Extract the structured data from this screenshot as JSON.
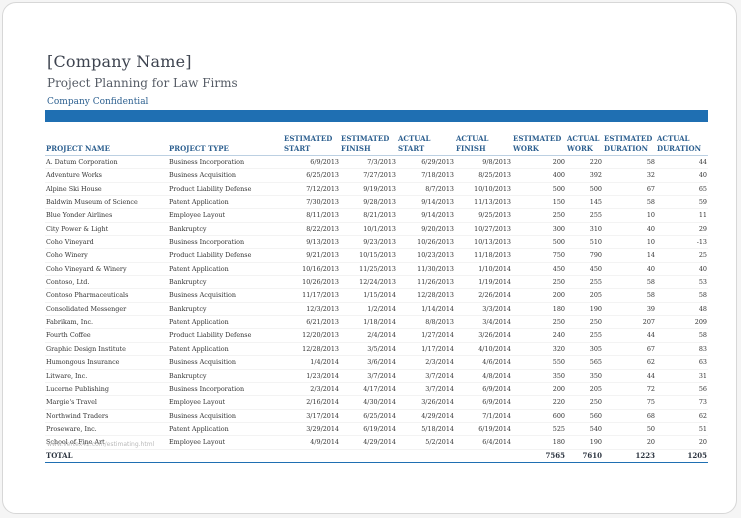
{
  "document": {
    "company": "[Company Name]",
    "subtitle": "Project Planning for Law Firms",
    "confidential": "Company Confidential",
    "footer": "www.vertex42.com/estimating.html"
  },
  "columns": [
    {
      "l1": "",
      "l2": "PROJECT NAME"
    },
    {
      "l1": "",
      "l2": "PROJECT TYPE"
    },
    {
      "l1": "ESTIMATED",
      "l2": "START"
    },
    {
      "l1": "ESTIMATED",
      "l2": "FINISH"
    },
    {
      "l1": "ACTUAL",
      "l2": "START"
    },
    {
      "l1": "ACTUAL",
      "l2": "FINISH"
    },
    {
      "l1": "ESTIMATED",
      "l2": "WORK"
    },
    {
      "l1": "ACTUAL",
      "l2": "WORK"
    },
    {
      "l1": "ESTIMATED",
      "l2": "DURATION"
    },
    {
      "l1": "ACTUAL",
      "l2": "DURATION"
    }
  ],
  "rows": [
    [
      "A. Datum Corporation",
      "Business Incorporation",
      "6/9/2013",
      "7/3/2013",
      "6/29/2013",
      "9/8/2013",
      "200",
      "220",
      "58",
      "44"
    ],
    [
      "Adventure Works",
      "Business Acquisition",
      "6/25/2013",
      "7/27/2013",
      "7/18/2013",
      "8/25/2013",
      "400",
      "392",
      "32",
      "40"
    ],
    [
      "Alpine Ski House",
      "Product Liability Defense",
      "7/12/2013",
      "9/19/2013",
      "8/7/2013",
      "10/10/2013",
      "500",
      "500",
      "67",
      "65"
    ],
    [
      "Baldwin Museum of Science",
      "Patent Application",
      "7/30/2013",
      "9/28/2013",
      "9/14/2013",
      "11/13/2013",
      "150",
      "145",
      "58",
      "59"
    ],
    [
      "Blue Yonder Airlines",
      "Employee Layout",
      "8/11/2013",
      "8/21/2013",
      "9/14/2013",
      "9/25/2013",
      "250",
      "255",
      "10",
      "11"
    ],
    [
      "City Power & Light",
      "Bankruptcy",
      "8/22/2013",
      "10/1/2013",
      "9/20/2013",
      "10/27/2013",
      "300",
      "310",
      "40",
      "29"
    ],
    [
      "Coho Vineyard",
      "Business Incorporation",
      "9/13/2013",
      "9/23/2013",
      "10/26/2013",
      "10/13/2013",
      "500",
      "510",
      "10",
      "-13"
    ],
    [
      "Coho Winery",
      "Product Liability Defense",
      "9/21/2013",
      "10/15/2013",
      "10/23/2013",
      "11/18/2013",
      "750",
      "790",
      "14",
      "25"
    ],
    [
      "Coho Vineyard & Winery",
      "Patent Application",
      "10/16/2013",
      "11/25/2013",
      "11/30/2013",
      "1/10/2014",
      "450",
      "450",
      "40",
      "40"
    ],
    [
      "Contoso, Ltd.",
      "Bankruptcy",
      "10/26/2013",
      "12/24/2013",
      "11/26/2013",
      "1/19/2014",
      "250",
      "255",
      "58",
      "53"
    ],
    [
      "Contoso Pharmaceuticals",
      "Business Acquisition",
      "11/17/2013",
      "1/15/2014",
      "12/28/2013",
      "2/26/2014",
      "200",
      "205",
      "58",
      "58"
    ],
    [
      "Consolidated Messenger",
      "Bankruptcy",
      "12/3/2013",
      "1/2/2014",
      "1/14/2014",
      "3/3/2014",
      "180",
      "190",
      "39",
      "48"
    ],
    [
      "Fabrikam, Inc.",
      "Patent Application",
      "6/21/2013",
      "1/18/2014",
      "8/8/2013",
      "3/4/2014",
      "250",
      "250",
      "207",
      "209"
    ],
    [
      "Fourth Coffee",
      "Product Liability Defense",
      "12/20/2013",
      "2/4/2014",
      "1/27/2014",
      "3/26/2014",
      "240",
      "255",
      "44",
      "58"
    ],
    [
      "Graphic Design Institute",
      "Patent Application",
      "12/28/2013",
      "3/5/2014",
      "1/17/2014",
      "4/10/2014",
      "320",
      "305",
      "67",
      "83"
    ],
    [
      "Humongous Insurance",
      "Business Acquisition",
      "1/4/2014",
      "3/6/2014",
      "2/3/2014",
      "4/6/2014",
      "550",
      "565",
      "62",
      "63"
    ],
    [
      "Litware, Inc.",
      "Bankruptcy",
      "1/23/2014",
      "3/7/2014",
      "3/7/2014",
      "4/8/2014",
      "350",
      "350",
      "44",
      "31"
    ],
    [
      "Lucerne Publishing",
      "Business Incorporation",
      "2/3/2014",
      "4/17/2014",
      "3/7/2014",
      "6/9/2014",
      "200",
      "205",
      "72",
      "56"
    ],
    [
      "Margie's Travel",
      "Employee Layout",
      "2/16/2014",
      "4/30/2014",
      "3/26/2014",
      "6/9/2014",
      "220",
      "250",
      "75",
      "73"
    ],
    [
      "Northwind Traders",
      "Business Acquisition",
      "3/17/2014",
      "6/25/2014",
      "4/29/2014",
      "7/1/2014",
      "600",
      "560",
      "68",
      "62"
    ],
    [
      "Proseware, Inc.",
      "Patent Application",
      "3/29/2014",
      "6/19/2014",
      "5/18/2014",
      "6/19/2014",
      "525",
      "540",
      "50",
      "51"
    ],
    [
      "School of Fine Art",
      "Employee Layout",
      "4/9/2014",
      "4/29/2014",
      "5/2/2014",
      "6/4/2014",
      "180",
      "190",
      "20",
      "20"
    ]
  ],
  "total": {
    "label": "TOTAL",
    "est_work": "7565",
    "act_work": "7610",
    "est_duration": "1223",
    "act_duration": "1205"
  }
}
